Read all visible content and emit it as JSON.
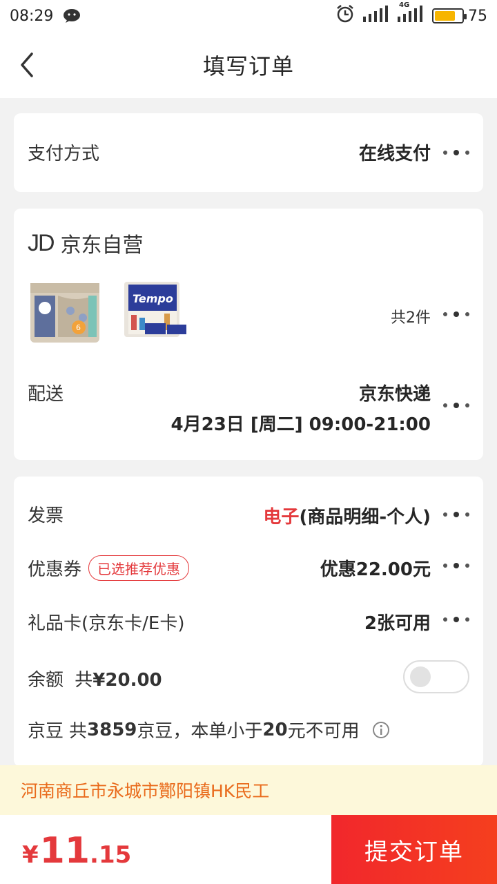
{
  "status_bar": {
    "time": "08:29",
    "battery": "75",
    "battery_fraction": 0.75,
    "network": "4G"
  },
  "header": {
    "title": "填写订单"
  },
  "payment": {
    "label": "支付方式",
    "value": "在线支付"
  },
  "shop": {
    "name": "京东自营",
    "logo_text": "JD",
    "products": [
      {
        "name": "Vinda tissue pack",
        "badge": "6"
      },
      {
        "name": "Tempo tissue pack",
        "brand": "Tempo"
      }
    ],
    "count_label": "共2件",
    "delivery_label": "配送",
    "delivery_method": "京东快递",
    "delivery_time": "4月23日 [周二] 09:00-21:00"
  },
  "options": {
    "invoice": {
      "label": "发票",
      "value_highlight": "电子",
      "value_rest": "(商品明细-个人)"
    },
    "coupon": {
      "label": "优惠券",
      "tag": "已选推荐优惠",
      "value": "优惠22.00元"
    },
    "gift_card": {
      "label": "礼品卡(京东卡/E卡)",
      "value": "2张可用"
    },
    "balance": {
      "label": "余额",
      "amount_prefix": "共",
      "amount": "¥20.00",
      "enabled": false
    },
    "jingdou": {
      "label": "京豆",
      "prefix": "共",
      "count": "3859",
      "suffix": "京豆，本单小于",
      "limit": "20",
      "tail": "元不可用"
    }
  },
  "address": {
    "text": "河南商丘市永城市酇阳镇HK民工"
  },
  "footer": {
    "price_symbol": "¥",
    "price_integer": "11",
    "price_decimal": ".15",
    "submit_label": "提交订单"
  },
  "colors": {
    "accent": "#e4393c",
    "address_bg": "#fdf8da",
    "address_text": "#e96b1c",
    "battery": "#f7b500"
  }
}
